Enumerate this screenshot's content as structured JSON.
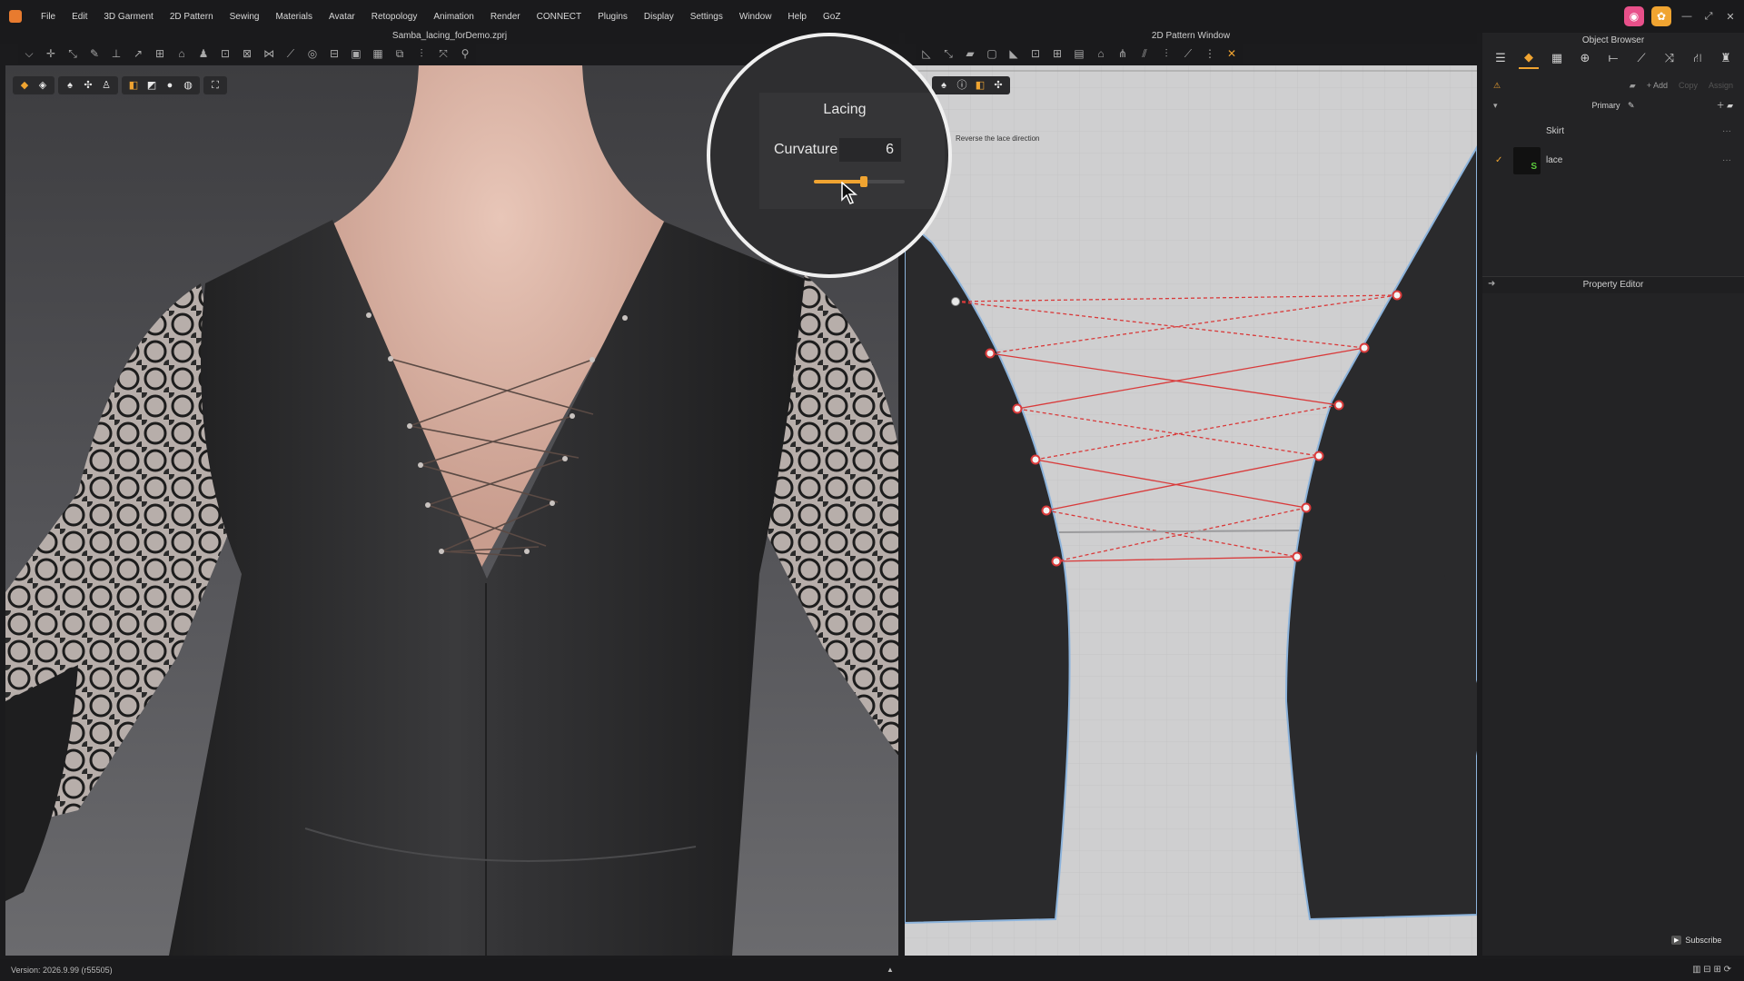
{
  "menu": [
    "File",
    "Edit",
    "3D Garment",
    "2D Pattern",
    "Sewing",
    "Materials",
    "Avatar",
    "Retopology",
    "Animation",
    "Render",
    "CONNECT",
    "Plugins",
    "Display",
    "Settings",
    "Window",
    "Help",
    "GoZ"
  ],
  "file_title": "Samba_lacing_forDemo.zprj",
  "pattern_window_title": "2D Pattern Window",
  "pattern_note": "Reverse the lace direction",
  "object_browser": {
    "title": "Object Browser",
    "actions": {
      "add": "+ Add",
      "copy": "Copy",
      "assign": "Assign"
    },
    "group": "Primary",
    "items": [
      {
        "label": "Skirt",
        "more": "···"
      },
      {
        "label": "lace",
        "badge": "S",
        "more": "···"
      }
    ]
  },
  "property_editor": {
    "title": "Property Editor"
  },
  "zoom": {
    "panel_title": "Lacing",
    "curvature_label": "Curvature",
    "curvature_value": "6",
    "curvature_fraction": 0.55
  },
  "status": {
    "version": "Version: 2026.9.99 (r55505)"
  },
  "subscribe": "Subscribe",
  "colors": {
    "accent": "#f0a431",
    "lace_red": "#d93a3a",
    "pattern_edge": "#8db4dc"
  },
  "icons": {
    "app": "clo-logo-icon",
    "badges": [
      "marvelous-icon",
      "clo-icon"
    ]
  }
}
